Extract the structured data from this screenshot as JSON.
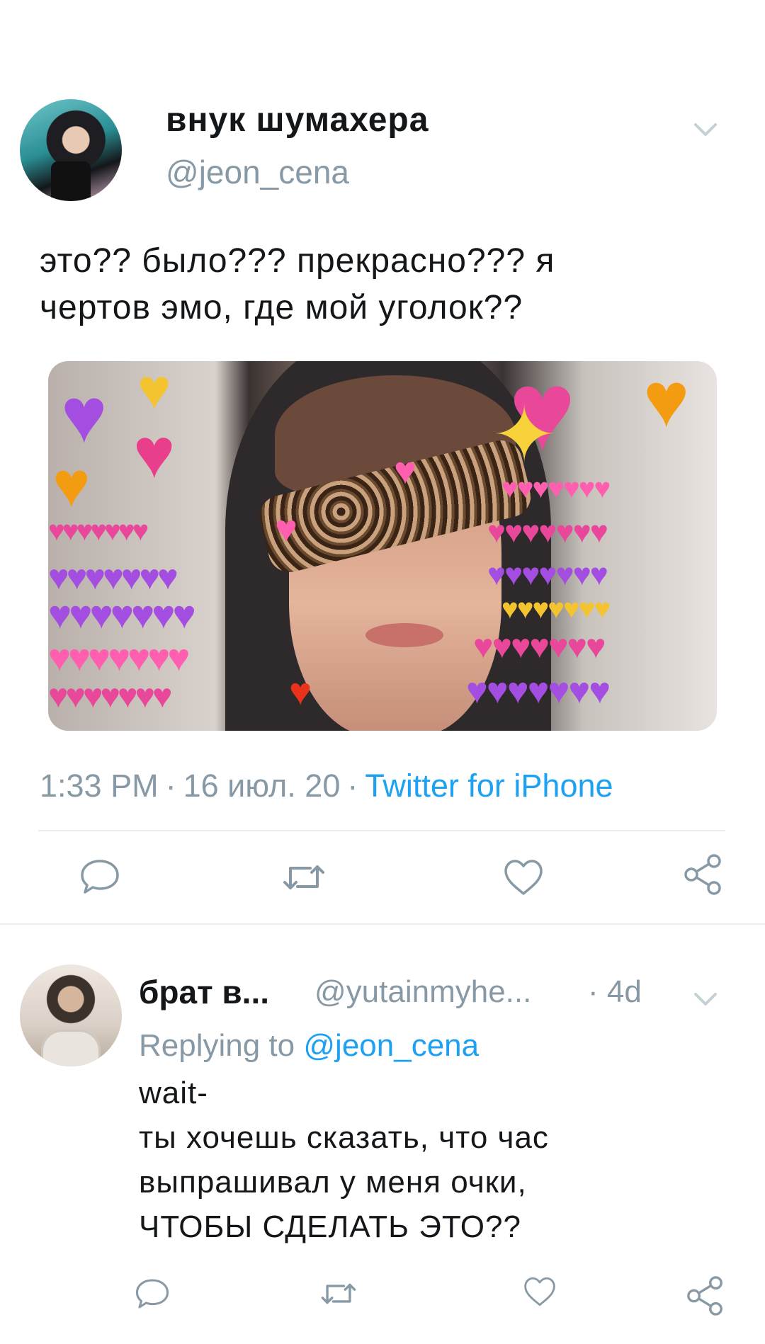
{
  "tweet": {
    "display_name": "внук шумахера",
    "handle": "@jeon_cena",
    "text_lines": [
      "это?? было??? прекрасно??? я",
      "чертов эмо, где мой уголок??"
    ],
    "time": "1:33 PM",
    "date": "16 июл. 20",
    "source": "Twitter for iPhone",
    "separator": "·",
    "media_icon": "photo",
    "actions": [
      "reply-icon",
      "retweet-icon",
      "like-icon",
      "share-icon"
    ]
  },
  "reply": {
    "display_name": "брат в...",
    "handle": "@yutainmyhe...",
    "time": "· 4d",
    "replying_prefix": "Replying to",
    "replying_mention": "@jeon_cena",
    "text_lines": [
      "wait-",
      "ты хочешь сказать, что час",
      "выпрашивал у меня очки,",
      "ЧТОБЫ СДЕЛАТЬ ЭТО??"
    ],
    "actions": [
      "reply-icon",
      "retweet-icon",
      "like-icon",
      "share-icon"
    ]
  },
  "colors": {
    "text": "#14171a",
    "secondary": "#8899a6",
    "link": "#1da1f2",
    "divider": "#e6ecf0"
  }
}
